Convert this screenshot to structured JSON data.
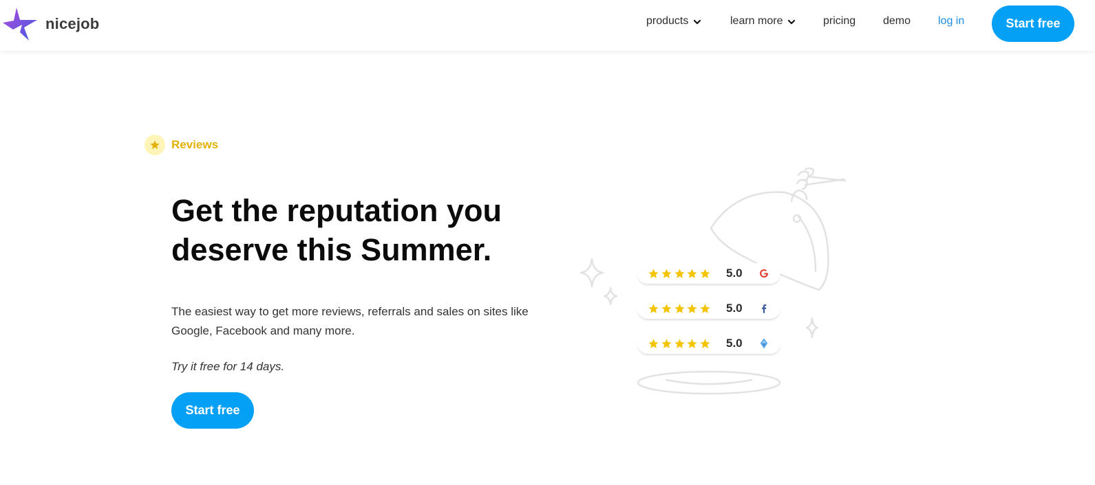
{
  "header": {
    "logo_text": "nicejob",
    "nav": {
      "products": "products",
      "learn_more": "learn more",
      "pricing": "pricing",
      "demo": "demo",
      "log_in": "log in"
    },
    "cta_label": "Start free"
  },
  "hero": {
    "badge_label": "Reviews",
    "headline_line1": "Get the reputation you",
    "headline_line2": "deserve this Summer.",
    "subtext": "The easiest way to get more reviews, referrals and sales on sites like Google, Facebook and many more.",
    "trial_note": "Try it free for 14 days.",
    "cta_label": "Start free"
  },
  "ratings": [
    {
      "stars": 5,
      "value": "5.0",
      "platform_icon": "google-icon"
    },
    {
      "stars": 5,
      "value": "5.0",
      "platform_icon": "facebook-icon"
    },
    {
      "stars": 5,
      "value": "5.0",
      "platform_icon": "homestars-icon"
    }
  ],
  "colors": {
    "accent": "#03a0f5",
    "badge": "#e3b208",
    "star": "#f5c400",
    "link": "#1a8fe3"
  }
}
